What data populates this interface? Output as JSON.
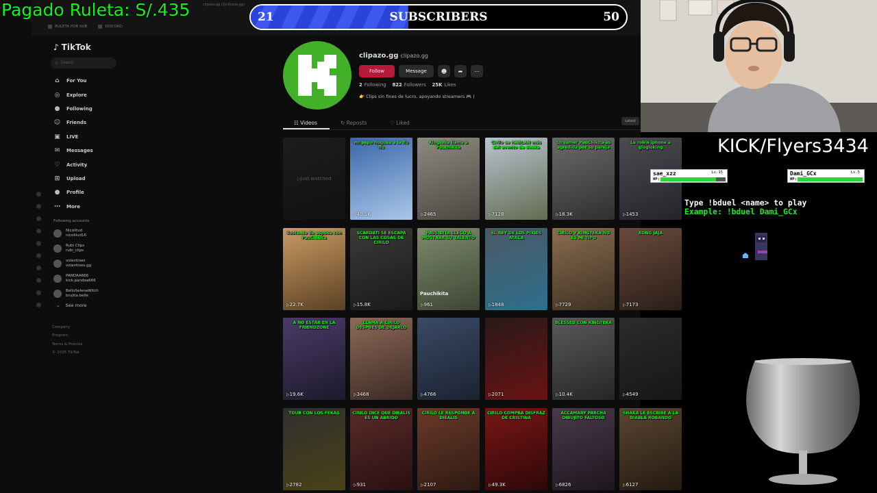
{
  "overlay": {
    "roulette_text": "Pagado Ruleta: S/.435",
    "subscribers": {
      "label": "SUBSCRIBERS",
      "current": "21",
      "goal": "50",
      "progress": 0.42
    },
    "channel_label": "KICK/Flyers3434",
    "duel": {
      "player1": {
        "name": "sae_xzz",
        "level": "Lv.15",
        "hp_label": "HP:",
        "hp_fraction": 0.85
      },
      "player2": {
        "name": "Dami_GCx",
        "level": "Lv.5",
        "hp_label": "HP:",
        "hp_fraction": 1.0
      },
      "instruction": "Type !bduel <name> to play",
      "example": "Example: !bduel Dami_GCx"
    }
  },
  "browser": {
    "tab_title": "clipazo.gg (@clipazo.gg)",
    "bookmarks": [
      "RULETA POR SUB",
      "DISCORD"
    ]
  },
  "sidebar": {
    "logo": "TikTok",
    "search_placeholder": "Search",
    "nav": [
      {
        "label": "For You",
        "icon": "home-icon",
        "glyph": "⌂"
      },
      {
        "label": "Explore",
        "icon": "compass-icon",
        "glyph": "◎"
      },
      {
        "label": "Following",
        "icon": "following-avatar-icon",
        "glyph": "●"
      },
      {
        "label": "Friends",
        "icon": "friends-icon",
        "glyph": "☺"
      },
      {
        "label": "LIVE",
        "icon": "live-icon",
        "glyph": "▣"
      },
      {
        "label": "Messages",
        "icon": "messages-icon",
        "glyph": "✉"
      },
      {
        "label": "Activity",
        "icon": "activity-icon",
        "glyph": "♡"
      },
      {
        "label": "Upload",
        "icon": "upload-icon",
        "glyph": "⊞"
      },
      {
        "label": "Profile",
        "icon": "profile-avatar-icon",
        "glyph": "●"
      },
      {
        "label": "More",
        "icon": "more-icon",
        "glyph": "⋯"
      }
    ],
    "following_title": "Following accounts",
    "following": [
      {
        "name": "Nicolitud",
        "handle": "nicoliiud16"
      },
      {
        "name": "Rubi Clips",
        "handle": "rubi_clips"
      },
      {
        "name": "volantines",
        "handle": "volantines.gg"
      },
      {
        "name": "PANDAA666",
        "handle": "kick.pandaa666"
      },
      {
        "name": "BelloSelenaWitch",
        "handle": "brujita.belle"
      }
    ],
    "see_more": "See more",
    "footer": [
      "Company",
      "Program",
      "Terms & Policies",
      "© 2025 TikTok"
    ]
  },
  "profile": {
    "name": "clipazo.gg",
    "handle": "clipazo.gg",
    "follow_label": "Follow",
    "message_label": "Message",
    "stats": [
      {
        "value": "2",
        "label": "Following"
      },
      {
        "value": "822",
        "label": "Followers"
      },
      {
        "value": "25K",
        "label": "Likes"
      }
    ],
    "bio": "👉 Clips sin fines de lucro, apoyando streamers 🎮 |"
  },
  "tabs": [
    "Videos",
    "Reposts",
    "Liked"
  ],
  "sort_label": "Latest",
  "videos": [
    {
      "caption": "",
      "views": "",
      "watched": "Just watched",
      "bg": [
        "#3a3a3a",
        "#1a1a1a"
      ],
      "dim": true
    },
    {
      "caption": "mr.popo noquea a la flu flu",
      "views": "40.1K",
      "bg": [
        "#3a66a8",
        "#a9c7e8"
      ]
    },
    {
      "caption": "Kingteka llama a Pauchikita",
      "views": "2465",
      "bg": [
        "#8d8a80",
        "#4a4842"
      ]
    },
    {
      "caption": "Cirilo se HABLAN más del evento de shaka",
      "views": "7128",
      "bg": [
        "#b7c4cf",
        "#646b52"
      ]
    },
    {
      "caption": "Streamer PauChikita es agredida por su pareja",
      "views": "18.3K",
      "bg": [
        "#6b6b6b",
        "#2f2f2f"
      ]
    },
    {
      "caption": "Le rob'n iphone a glogloking",
      "views": "1453",
      "bg": [
        "#4d4a52",
        "#26232a"
      ]
    },
    {
      "caption": "Sustento de esposa con PauChikita",
      "views": "22.7K",
      "bg": [
        "#c99b62",
        "#5b4125"
      ]
    },
    {
      "caption": "SCARDATI SE ESCAPA CON LAS COSAS DE CIRILO",
      "views": "15.8K",
      "bg": [
        "#3b3a38",
        "#1b1a18"
      ]
    },
    {
      "caption": "PAUSIDITA LLEGO A MOSTRAR SU TALENTO",
      "views": "961",
      "name_tag": "Pauchikita",
      "bg": [
        "#7e8a6e",
        "#3d4633"
      ]
    },
    {
      "caption": "EL REY DE LOS PIXIES ATACA",
      "views": "1848",
      "bg": [
        "#4a5966",
        "#2e6f8b"
      ]
    },
    {
      "caption": "CIRILO Y KINGTEKA NO ES MI TIPO",
      "views": "7729",
      "bg": [
        "#8a6e50",
        "#3e3022"
      ]
    },
    {
      "caption": "KONG JAJA",
      "views": "7173",
      "bg": [
        "#6a4a3c",
        "#2a1e18"
      ]
    },
    {
      "caption": "A NO ESTAR EN LA FRIENDZONE",
      "views": "19.6K",
      "bg": [
        "#4a3b6a",
        "#1d1a2a"
      ]
    },
    {
      "caption": "LLAMA A CIRILO DESPUES DE DEJARLO",
      "views": "3468",
      "bg": [
        "#8e6a58",
        "#3c2a24"
      ]
    },
    {
      "caption": "",
      "views": "4766",
      "bg": [
        "#3a4a66",
        "#1c2231"
      ]
    },
    {
      "caption": "",
      "views": "2071",
      "bg": [
        "#2a1a1a",
        "#6a1212"
      ]
    },
    {
      "caption": "BLESSED CON KINGTEKA",
      "views": "10.4K",
      "bg": [
        "#5a5a5a",
        "#262626"
      ]
    },
    {
      "caption": "",
      "views": "4549",
      "bg": [
        "#2c2c2c",
        "#161616"
      ]
    },
    {
      "caption": "TOUR CON LOS FEKAS",
      "views": "2782",
      "bg": [
        "#2f2f2f",
        "#4a4216"
      ]
    },
    {
      "caption": "CIRILO DICE QUE DIEALIS ES UN ABRIDO",
      "views": "931",
      "bg": [
        "#5a2a2a",
        "#2a1010"
      ]
    },
    {
      "caption": "CIRILO LE RESPONDE A DIEALIS",
      "views": "2107",
      "bg": [
        "#6a3a2a",
        "#2e1a12"
      ]
    },
    {
      "caption": "CIRILO COMPRA DISFRAZ DE CRISTINA",
      "views": "49.3K",
      "bg": [
        "#7a1616",
        "#2e0808"
      ]
    },
    {
      "caption": "ACCAMARY PARCHA DIBUJITO FALTOSO",
      "views": "6826",
      "bg": [
        "#4a3a4a",
        "#1e161e"
      ]
    },
    {
      "caption": "SHAKA LE ESCRIBE A LA DIABLA ROBANDO",
      "views": "6127",
      "bg": [
        "#5a4632",
        "#241a10"
      ]
    }
  ]
}
